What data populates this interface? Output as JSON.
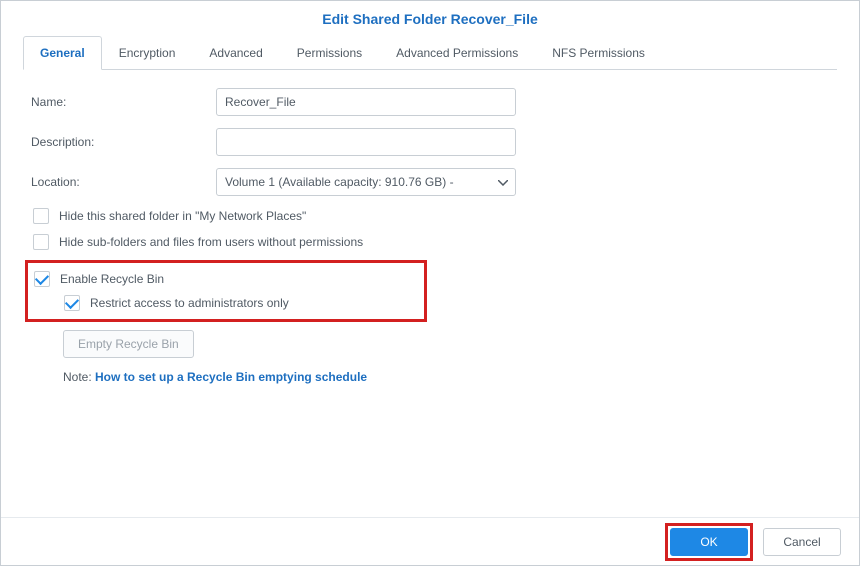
{
  "dialog": {
    "title": "Edit Shared Folder Recover_File"
  },
  "tabs": {
    "general": "General",
    "encryption": "Encryption",
    "advanced": "Advanced",
    "permissions": "Permissions",
    "advanced_permissions": "Advanced Permissions",
    "nfs_permissions": "NFS Permissions"
  },
  "form": {
    "name_label": "Name:",
    "name_value": "Recover_File",
    "description_label": "Description:",
    "description_value": "",
    "location_label": "Location:",
    "location_value": "Volume 1 (Available capacity: 910.76 GB) -"
  },
  "checkboxes": {
    "hide_network": "Hide this shared folder in \"My Network Places\"",
    "hide_subfolders": "Hide sub-folders and files from users without permissions",
    "enable_recycle": "Enable Recycle Bin",
    "restrict_admin": "Restrict access to administrators only"
  },
  "buttons": {
    "empty_recycle": "Empty Recycle Bin",
    "ok": "OK",
    "cancel": "Cancel"
  },
  "note": {
    "prefix": "Note: ",
    "link": "How to set up a Recycle Bin emptying schedule"
  }
}
